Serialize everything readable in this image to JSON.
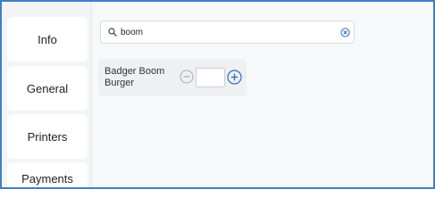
{
  "sidebar": {
    "items": [
      {
        "label": "Info"
      },
      {
        "label": "General"
      },
      {
        "label": "Printers"
      },
      {
        "label": "Payments Terminal"
      }
    ]
  },
  "search": {
    "value": "boom",
    "icon": "search-icon",
    "clear_icon": "clear-circle-icon"
  },
  "results": [
    {
      "name": "Badger Boom Burger",
      "quantity": "",
      "minus_icon": "minus-circle-icon",
      "plus_icon": "plus-circle-icon"
    }
  ],
  "colors": {
    "frame_border": "#3f7fc4",
    "accent": "#2f6db5",
    "disabled": "#a6abb3"
  }
}
